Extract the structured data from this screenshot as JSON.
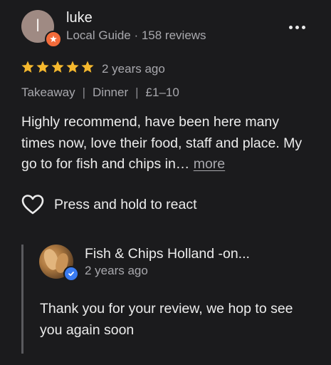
{
  "review": {
    "avatar_letter": "l",
    "reviewer_name": "luke",
    "reviewer_meta": "Local Guide · 158 reviews",
    "rating": 5,
    "rating_max": 5,
    "date": "2 years ago",
    "tags": [
      "Takeaway",
      "Dinner",
      "£1–10"
    ],
    "tag_separator": "|",
    "text": "Highly recommend, have been here many times now, love their food, staff and place. My go to for fish and chips in…",
    "more_label": "more",
    "react_label": "Press and hold to react"
  },
  "owner_response": {
    "name": "Fish & Chips Holland -on...",
    "date": "2 years ago",
    "text": "Thank you for your review, we hop to see you again soon"
  },
  "icons": {
    "more_options": "more-options-icon",
    "heart": "heart-icon",
    "star": "star-icon",
    "local_guide": "local-guide-badge-icon",
    "verified": "verified-badge-icon"
  },
  "colors": {
    "background": "#1b1b1d",
    "star": "#f5b82e",
    "local_guide_badge": "#f36b3a",
    "verified_badge": "#3a7bf0",
    "secondary_text": "#a8a8ad"
  }
}
